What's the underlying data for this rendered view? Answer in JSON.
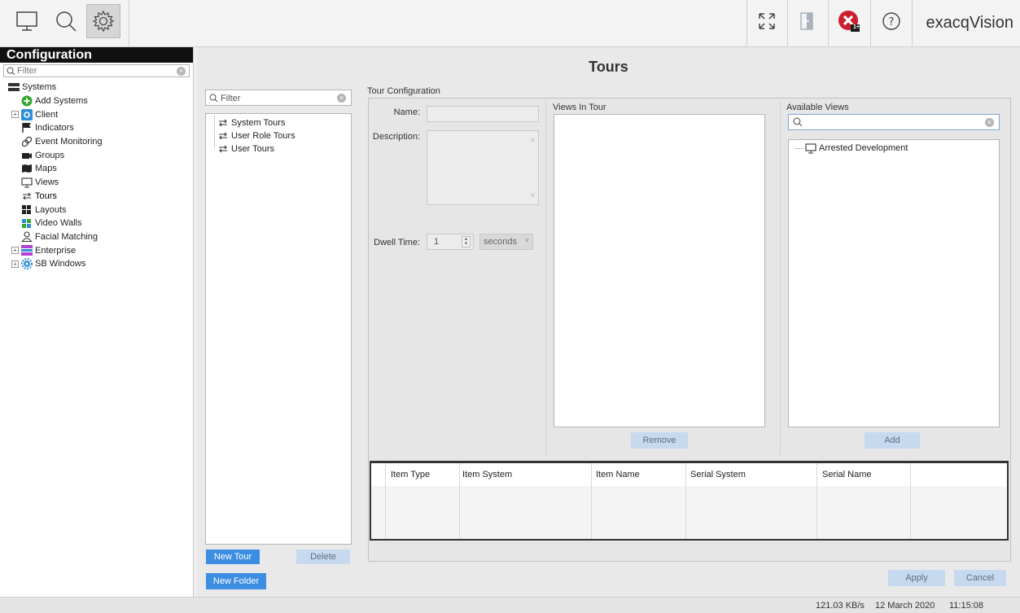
{
  "app": {
    "brand": "exacqVision"
  },
  "toolbar": {
    "icons": [
      "monitor-icon",
      "search-icon",
      "gear-icon",
      "fullscreen-icon",
      "exit-icon",
      "alarm-icon",
      "help-icon"
    ],
    "alarm_badge": "1+",
    "accent": "#cc1f2d"
  },
  "sidebar": {
    "title": "Configuration",
    "filter_placeholder": "Filter",
    "items": [
      {
        "label": "Systems",
        "icon": "server-icon",
        "level": 0
      },
      {
        "label": "Add Systems",
        "icon": "plus-icon",
        "level": 1
      },
      {
        "label": "Client",
        "icon": "gear-icon",
        "level": 1,
        "expandable": true
      },
      {
        "label": "Indicators",
        "icon": "flag-icon",
        "level": 1
      },
      {
        "label": "Event Monitoring",
        "icon": "link-icon",
        "level": 1
      },
      {
        "label": "Groups",
        "icon": "camera-icon",
        "level": 1
      },
      {
        "label": "Maps",
        "icon": "map-icon",
        "level": 1
      },
      {
        "label": "Views",
        "icon": "monitor-icon",
        "level": 1
      },
      {
        "label": "Tours",
        "icon": "tour-icon",
        "level": 1,
        "selected": true
      },
      {
        "label": "Layouts",
        "icon": "layout-icon",
        "level": 1
      },
      {
        "label": "Video Walls",
        "icon": "videowall-icon",
        "level": 1
      },
      {
        "label": "Facial Matching",
        "icon": "person-icon",
        "level": 1
      },
      {
        "label": "Enterprise",
        "icon": "enterprise-icon",
        "level": 0,
        "expandable": true
      },
      {
        "label": "SB Windows",
        "icon": "gear-icon",
        "level": 0,
        "expandable": true
      }
    ]
  },
  "main": {
    "title": "Tours",
    "list": {
      "filter_placeholder": "Filter",
      "items": [
        "System Tours",
        "User Role Tours",
        "User Tours"
      ],
      "new_tour": "New Tour",
      "delete": "Delete",
      "new_folder": "New Folder"
    },
    "config": {
      "group_label": "Tour Configuration",
      "name_label": "Name:",
      "name_value": "",
      "description_label": "Description:",
      "dwell_label": "Dwell Time:",
      "dwell_value": "1",
      "dwell_unit": "seconds",
      "views_in_tour_label": "Views In Tour",
      "remove": "Remove",
      "available_views_label": "Available Views",
      "available_views": [
        "Arrested Development"
      ],
      "add": "Add"
    },
    "table": {
      "columns": [
        "Item Type",
        "Item System",
        "Item Name",
        "Serial System",
        "Serial Name"
      ]
    },
    "apply": "Apply",
    "cancel": "Cancel"
  },
  "status": {
    "bandwidth": "121.03 KB/s",
    "date": "12 March 2020",
    "time": "11:15:08"
  }
}
